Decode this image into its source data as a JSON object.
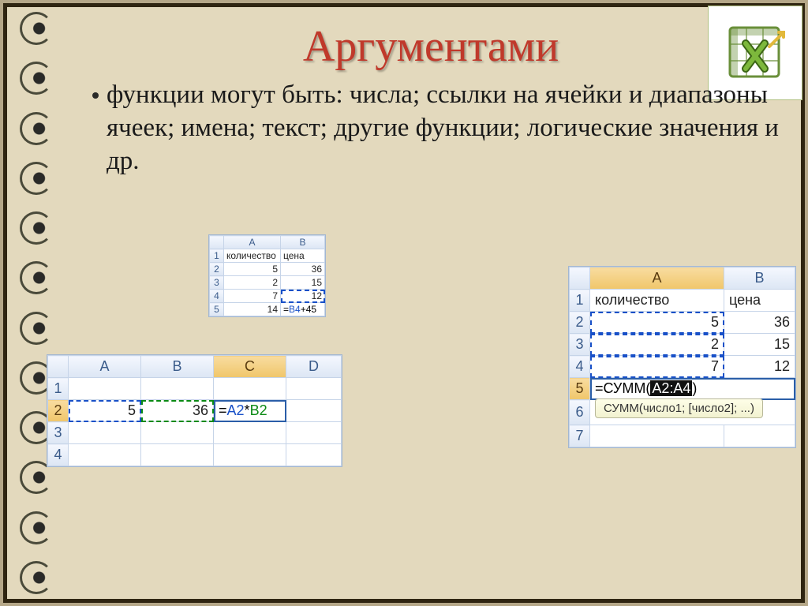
{
  "title": "Аргументами",
  "bullet": "функции могут быть: числа; ссылки на ячейки и диапазоны ячеек; имена; текст; другие функции; логические значения и др.",
  "table1": {
    "cols": [
      "A",
      "B"
    ],
    "rows": [
      {
        "r": "1",
        "a": "количество",
        "b": "цена"
      },
      {
        "r": "2",
        "a": "5",
        "b": "36"
      },
      {
        "r": "3",
        "a": "2",
        "b": "15"
      },
      {
        "r": "4",
        "a": "7",
        "b": "12"
      },
      {
        "r": "5",
        "a": "14",
        "b_formula_eq": "=",
        "b_formula_ref": "B4",
        "b_formula_rest": "+45"
      }
    ]
  },
  "table2": {
    "cols": [
      "A",
      "B",
      "C",
      "D"
    ],
    "rows": [
      {
        "r": "1"
      },
      {
        "r": "2",
        "a": "5",
        "b": "36",
        "c_eq": "=",
        "c_a": "A2",
        "c_op": "*",
        "c_b": "B2"
      },
      {
        "r": "3"
      },
      {
        "r": "4"
      }
    ]
  },
  "table3": {
    "cols": [
      "A",
      "B"
    ],
    "rows": [
      {
        "r": "1",
        "a": "количество",
        "b": "цена"
      },
      {
        "r": "2",
        "a": "5",
        "b": "36"
      },
      {
        "r": "3",
        "a": "2",
        "b": "15"
      },
      {
        "r": "4",
        "a": "7",
        "b": "12"
      },
      {
        "r": "5",
        "a_eq": "=СУММ(",
        "a_range": "A2:A4",
        "a_close": ")"
      },
      {
        "r": "6"
      },
      {
        "r": "7"
      }
    ],
    "tooltip": "СУММ(число1; [число2]; ...)"
  }
}
